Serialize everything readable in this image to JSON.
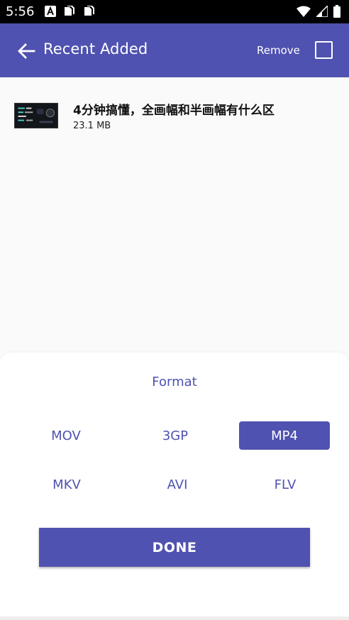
{
  "status_bar": {
    "time": "5:56"
  },
  "app_bar": {
    "title": "Recent Added",
    "remove_label": "Remove"
  },
  "colors": {
    "primary": "#4f52b0",
    "background": "#fafafa",
    "sheet": "#ffffff"
  },
  "items": [
    {
      "title": "4分钟搞懂，全画幅和半画幅有什么区",
      "size": "23.1 MB"
    }
  ],
  "format_sheet": {
    "title": "Format",
    "formats": [
      "MOV",
      "3GP",
      "MP4",
      "MKV",
      "AVI",
      "FLV"
    ],
    "selected": "MP4",
    "done_label": "DONE"
  }
}
